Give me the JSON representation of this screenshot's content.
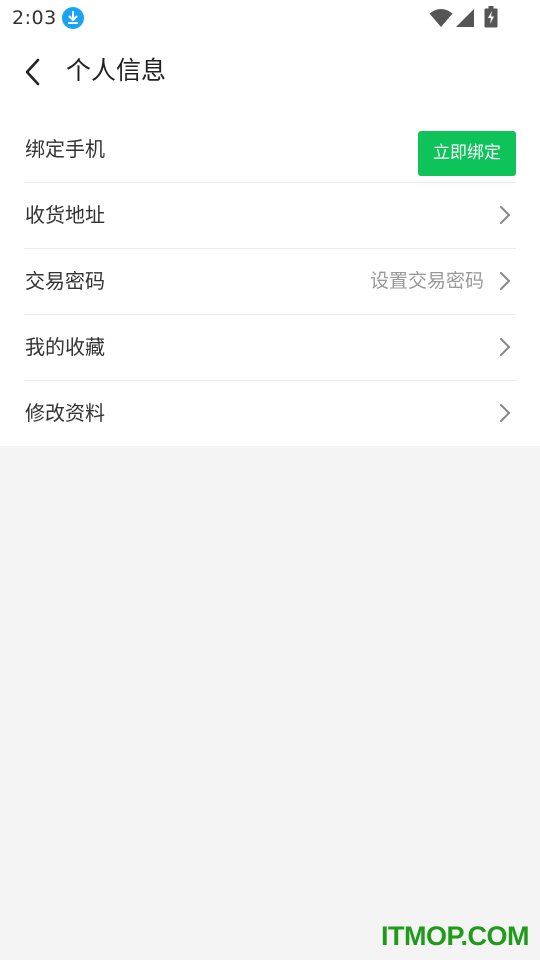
{
  "status_bar": {
    "time": "2:03",
    "icons": [
      "download-icon",
      "wifi-icon",
      "signal-icon",
      "battery-icon"
    ]
  },
  "header": {
    "back_icon": "chevron-left-icon",
    "title": "个人信息"
  },
  "menu": {
    "bind_phone": {
      "label": "绑定手机",
      "button_label": "立即绑定"
    },
    "items": [
      {
        "label": "收货地址",
        "value": "",
        "icon": "chevron-right-icon"
      },
      {
        "label": "交易密码",
        "value": "设置交易密码",
        "icon": "chevron-right-icon"
      },
      {
        "label": "我的收藏",
        "value": "",
        "icon": "chevron-right-icon"
      },
      {
        "label": "修改资料",
        "value": "",
        "icon": "chevron-right-icon"
      }
    ]
  },
  "watermark": "ITMOP.COM",
  "colors": {
    "accent_green": "#0dc35a",
    "watermark_green": "#1f9a1a",
    "download_badge": "#1aa3f5",
    "background": "#f4f4f4"
  }
}
